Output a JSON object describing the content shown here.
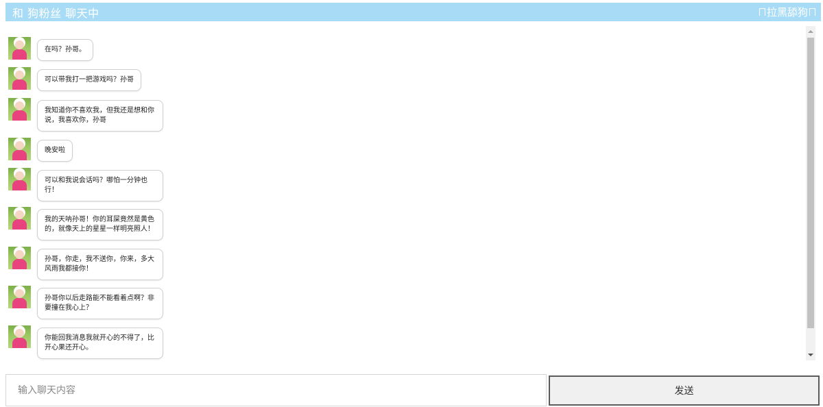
{
  "header": {
    "title": "和 狗粉丝 聊天中",
    "block_label": "拉黑舔狗"
  },
  "messages": [
    {
      "text": "在吗？孙哥。"
    },
    {
      "text": "可以带我打一把游戏吗？孙哥"
    },
    {
      "text": "我知道你不喜欢我，但我还是想和你说，我喜欢你，孙哥"
    },
    {
      "text": "晚安啦"
    },
    {
      "text": "可以和我说会话吗？哪怕一分钟也行！"
    },
    {
      "text": "我的天呐孙哥！你的耳屎竟然是黄色的，就像天上的星星一样明亮照人！"
    },
    {
      "text": "孙哥，你走，我不送你，你来，多大风雨我都接你！"
    },
    {
      "text": "孙哥你以后走路能不能看着点啊？非要撞在我心上？"
    },
    {
      "text": "你能回我消息我就开心的不得了，比开心果还开心。"
    }
  ],
  "composer": {
    "placeholder": "输入聊天内容",
    "value": "",
    "send_label": "发送"
  }
}
